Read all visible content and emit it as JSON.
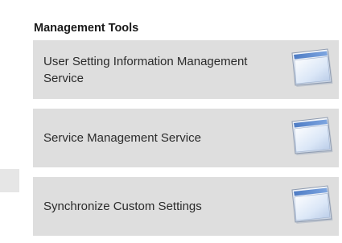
{
  "section": {
    "title": "Management Tools"
  },
  "tools": [
    {
      "label": "User Setting Information Management Service",
      "icon": "window-icon"
    },
    {
      "label": "Service Management Service",
      "icon": "window-icon"
    },
    {
      "label": "Synchronize Custom Settings",
      "icon": "window-icon"
    }
  ],
  "colors": {
    "tile_background": "#dedede",
    "icon_blue": "#5b84c4"
  }
}
